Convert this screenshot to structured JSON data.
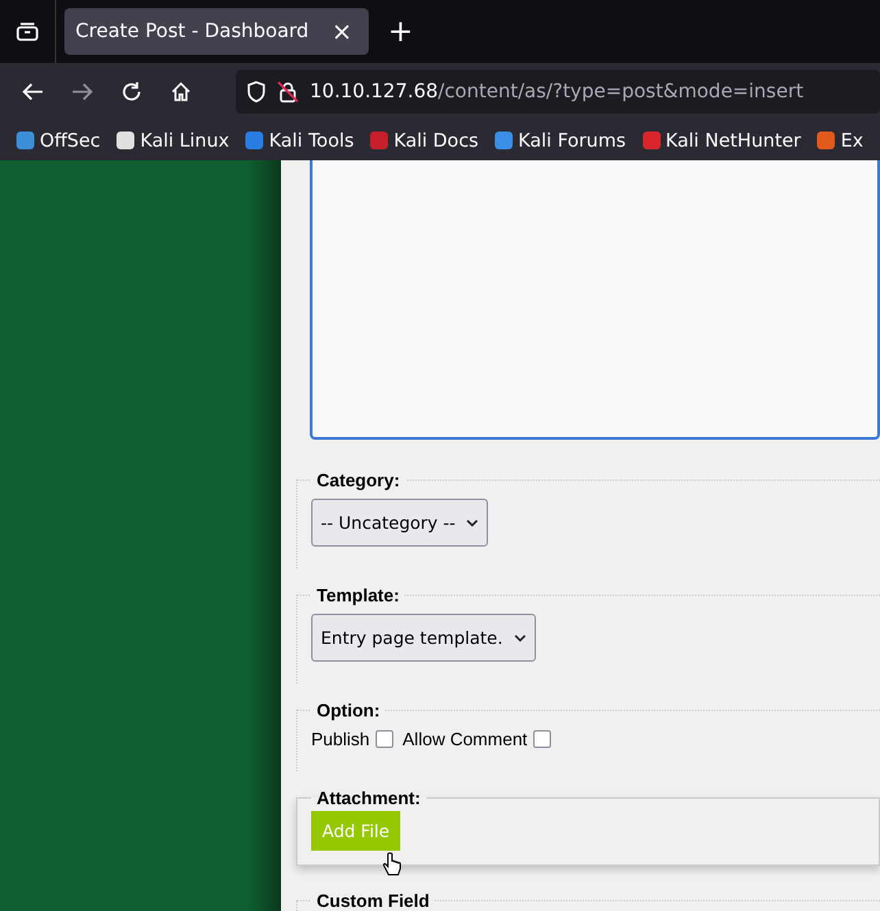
{
  "tab": {
    "title": "Create Post - Dashboard",
    "close": "×",
    "new_tab": "+"
  },
  "address": {
    "host": "10.10.127.68",
    "path": "/content/as/?type=post&mode=insert"
  },
  "bookmarks": [
    {
      "label": "OffSec",
      "color": "#3b8fd6"
    },
    {
      "label": "Kali Linux",
      "color": "#e0e0e0"
    },
    {
      "label": "Kali Tools",
      "color": "#2a7de1"
    },
    {
      "label": "Kali Docs",
      "color": "#c8202a"
    },
    {
      "label": "Kali Forums",
      "color": "#3a8ee6"
    },
    {
      "label": "Kali NetHunter",
      "color": "#d9262c"
    },
    {
      "label": "Ex",
      "color": "#e05a1c"
    }
  ],
  "form": {
    "category": {
      "legend": "Category:",
      "value": "-- Uncategory --"
    },
    "template": {
      "legend": "Template:",
      "value": "Entry page template."
    },
    "option": {
      "legend": "Option:",
      "checks": [
        {
          "label": "Publish",
          "checked": false
        },
        {
          "label": "Allow Comment",
          "checked": false
        }
      ]
    },
    "attachment": {
      "legend": "Attachment:",
      "button": "Add File"
    },
    "custom_field": {
      "legend": "Custom Field"
    }
  }
}
